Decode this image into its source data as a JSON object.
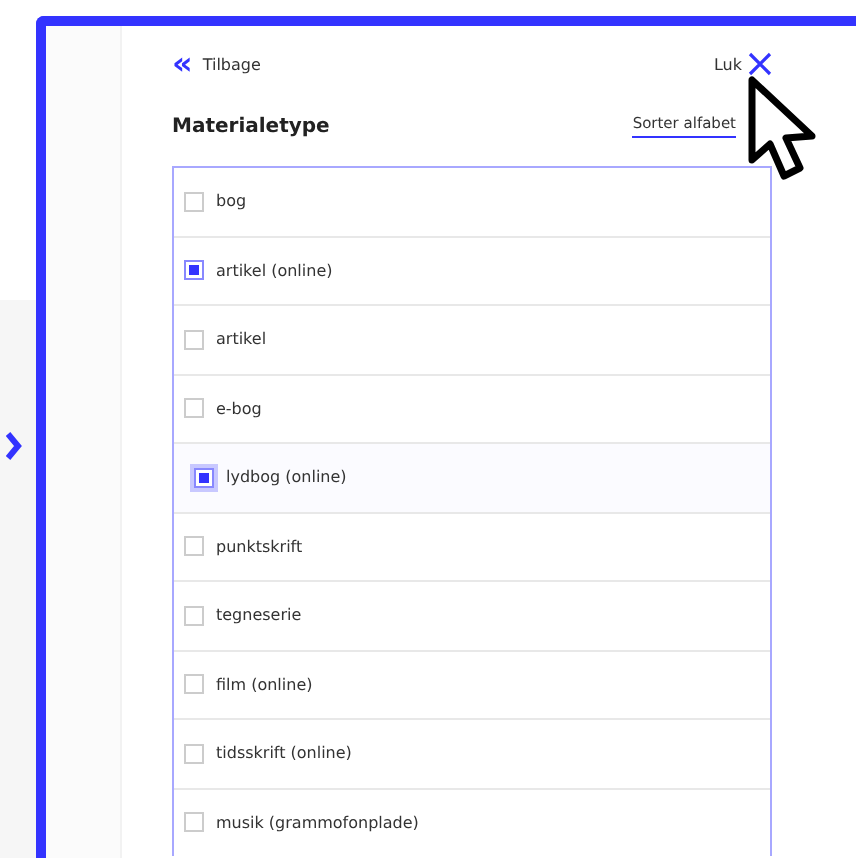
{
  "back_link": {
    "icon": "«",
    "label": "Tilbage"
  },
  "close_button": {
    "label": "Luk"
  },
  "heading": "Materialetype",
  "sort_link": "Sorter alfabet",
  "options": [
    {
      "label": "bog",
      "checked": false,
      "focused": false
    },
    {
      "label": "artikel (online)",
      "checked": true,
      "focused": false
    },
    {
      "label": "artikel",
      "checked": false,
      "focused": false
    },
    {
      "label": "e-bog",
      "checked": false,
      "focused": false
    },
    {
      "label": "lydbog (online)",
      "checked": true,
      "focused": true
    },
    {
      "label": "punktskrift",
      "checked": false,
      "focused": false
    },
    {
      "label": "tegneserie",
      "checked": false,
      "focused": false
    },
    {
      "label": "film (online)",
      "checked": false,
      "focused": false
    },
    {
      "label": "tidsskrift (online)",
      "checked": false,
      "focused": false
    },
    {
      "label": "musik (grammofonplade)",
      "checked": false,
      "focused": false
    }
  ]
}
